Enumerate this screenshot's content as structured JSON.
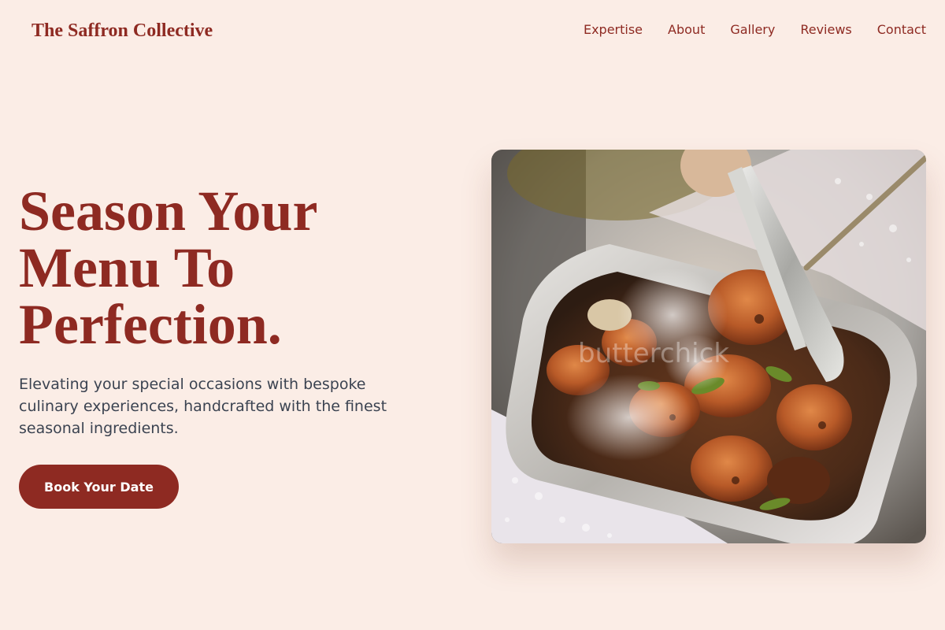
{
  "header": {
    "brand": "The Saffron Collective",
    "nav": [
      "Expertise",
      "About",
      "Gallery",
      "Reviews",
      "Contact"
    ]
  },
  "hero": {
    "title_lines": [
      "Season Your",
      "Menu To",
      "Perfection."
    ],
    "subtitle": "Elevating your special occasions with bespoke culinary experiences, handcrafted with the finest seasonal ingredients.",
    "cta_label": "Book Your Date",
    "image_watermark": "butterchick"
  },
  "colors": {
    "background": "#fbede6",
    "brand": "#8e2a22",
    "body_text": "#3b4351"
  }
}
